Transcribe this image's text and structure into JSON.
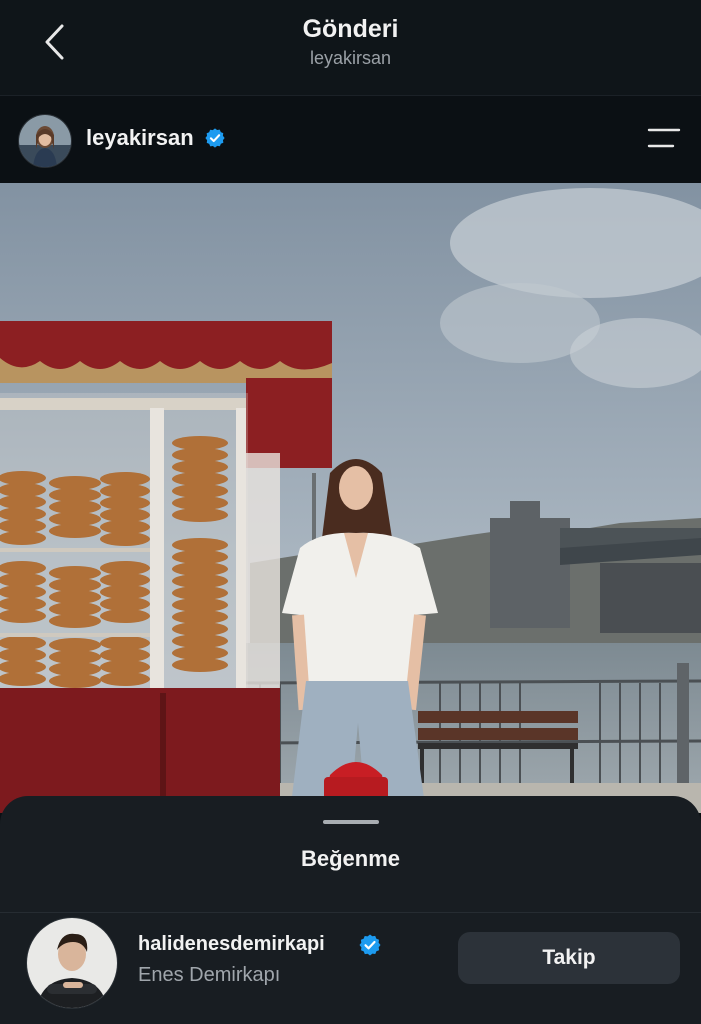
{
  "header": {
    "title": "Gönderi",
    "subtitle": "leyakirsan"
  },
  "post": {
    "username": "leyakirsan",
    "verified": true
  },
  "sheet": {
    "title": "Beğenme",
    "users": [
      {
        "handle": "halidenesdemirkapi",
        "full_name": "Enes Demirkapı",
        "verified": true,
        "button_label": "Takip"
      }
    ]
  },
  "colors": {
    "background": "#0b1014",
    "sheet": "#181d22",
    "button": "#2c3239",
    "verified": "#1d9bf0"
  },
  "icons": {
    "back": "chevron-left-icon",
    "verified": "verified-badge-icon",
    "menu": "menu-lines-icon"
  }
}
